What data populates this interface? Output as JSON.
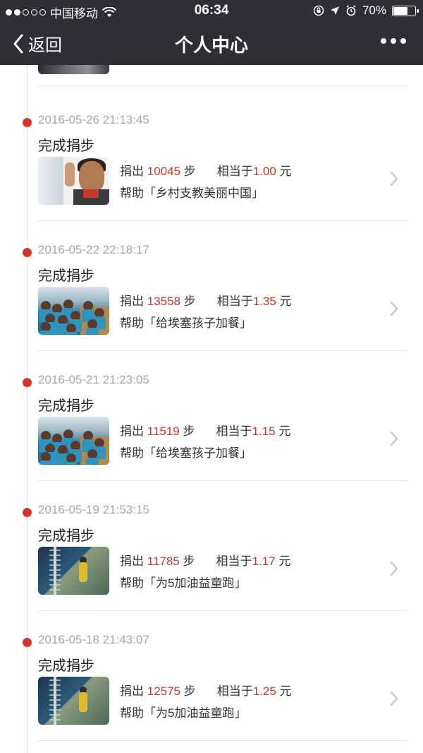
{
  "status_bar": {
    "carrier": "中国移动",
    "time": "06:34",
    "battery": "70%",
    "battery_level": 0.7,
    "icons": [
      "signal-dots-icon",
      "wifi-icon",
      "lock-rotation-icon",
      "location-icon",
      "alarm-icon",
      "battery-icon"
    ]
  },
  "nav": {
    "back_label": "返回",
    "title": "个人中心",
    "more_icon": "more-dots-icon"
  },
  "colors": {
    "nav_bg": "#2f2f33",
    "accent_red": "#d83326",
    "timestamp_gray": "#a8a8a8"
  },
  "entries": [
    {
      "timestamp": "2016-05-26 21:13:45",
      "action": "完成捐步",
      "donate_prefix": "捐出",
      "steps": "10045",
      "steps_unit": "步",
      "equiv_prefix": "相当于",
      "amount": "1.00",
      "amount_unit": "元",
      "help_text": "帮助「乡村支教美丽中国」",
      "thumbnail": "classroom-boy-raising-hand"
    },
    {
      "timestamp": "2016-05-22 22:18:17",
      "action": "完成捐步",
      "donate_prefix": "捐出",
      "steps": "13558",
      "steps_unit": "步",
      "equiv_prefix": "相当于",
      "amount": "1.35",
      "amount_unit": "元",
      "help_text": "帮助「给埃塞孩子加餐」",
      "thumbnail": "ethiopian-children-classroom"
    },
    {
      "timestamp": "2016-05-21 21:23:05",
      "action": "完成捐步",
      "donate_prefix": "捐出",
      "steps": "11519",
      "steps_unit": "步",
      "equiv_prefix": "相当于",
      "amount": "1.15",
      "amount_unit": "元",
      "help_text": "帮助「给埃塞孩子加餐」",
      "thumbnail": "ethiopian-children-classroom"
    },
    {
      "timestamp": "2016-05-19 21:53:15",
      "action": "完成捐步",
      "donate_prefix": "捐出",
      "steps": "11785",
      "steps_unit": "步",
      "equiv_prefix": "相当于",
      "amount": "1.17",
      "amount_unit": "元",
      "help_text": "帮助「为5加油益童跑」",
      "thumbnail": "child-running"
    },
    {
      "timestamp": "2016-05-18 21:43:07",
      "action": "完成捐步",
      "donate_prefix": "捐出",
      "steps": "12575",
      "steps_unit": "步",
      "equiv_prefix": "相当于",
      "amount": "1.25",
      "amount_unit": "元",
      "help_text": "帮助「为5加油益童跑」",
      "thumbnail": "child-running"
    }
  ]
}
